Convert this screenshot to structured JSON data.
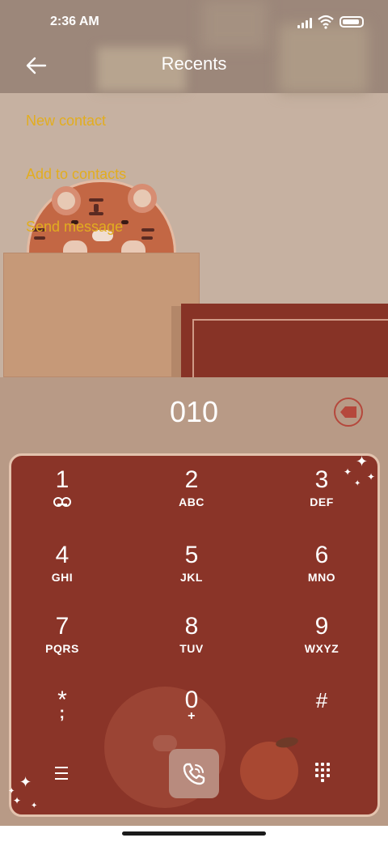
{
  "status_bar": {
    "time": "2:36 AM"
  },
  "header": {
    "title": "Recents",
    "back_icon": "arrow-left-icon"
  },
  "options": [
    {
      "label": "New contact"
    },
    {
      "label": "Add to contacts"
    },
    {
      "label": "Send message"
    }
  ],
  "dialer": {
    "number": "010",
    "keys": [
      {
        "digit": "1",
        "letters": ""
      },
      {
        "digit": "2",
        "letters": "ABC"
      },
      {
        "digit": "3",
        "letters": "DEF"
      },
      {
        "digit": "4",
        "letters": "GHI"
      },
      {
        "digit": "5",
        "letters": "JKL"
      },
      {
        "digit": "6",
        "letters": "MNO"
      },
      {
        "digit": "7",
        "letters": "PQRS"
      },
      {
        "digit": "8",
        "letters": "TUV"
      },
      {
        "digit": "9",
        "letters": "WXYZ"
      },
      {
        "digit": "*",
        "letters": ";"
      },
      {
        "digit": "0",
        "letters": "+"
      },
      {
        "digit": "#",
        "letters": ""
      }
    ]
  },
  "colors": {
    "accent": "#e2ad1f",
    "pad": "#8a3428",
    "background": "#b89a86"
  }
}
